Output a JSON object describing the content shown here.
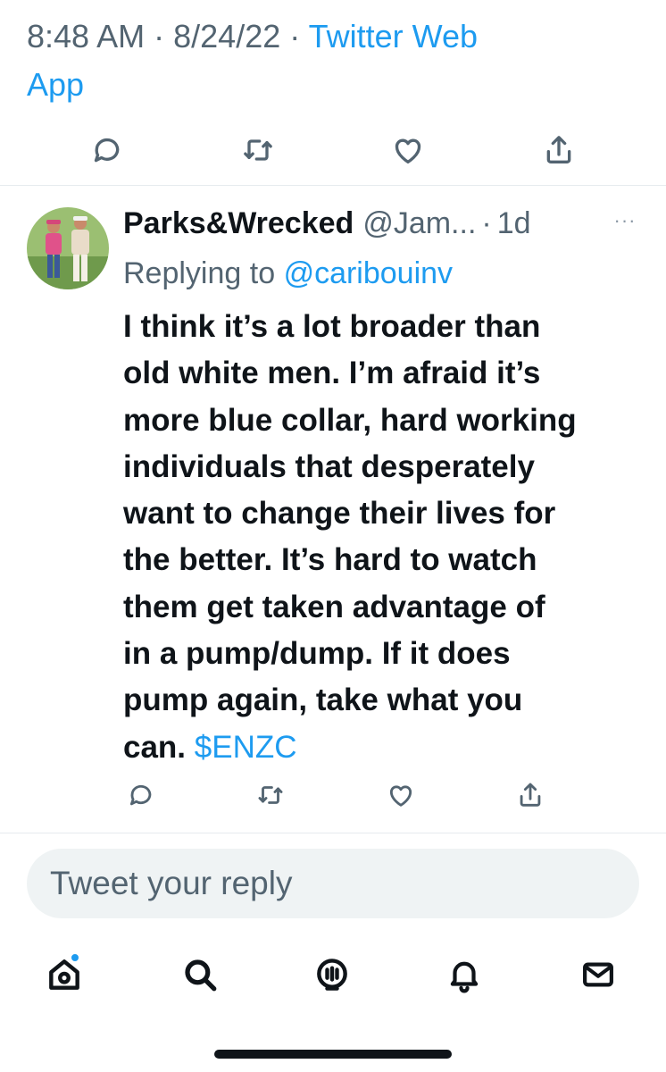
{
  "meta": {
    "time": "8:48 AM",
    "date": "8/24/22",
    "separator": "·",
    "source": "Twitter Web",
    "source_cont": "App"
  },
  "tweet": {
    "display_name": "Parks&Wrecked",
    "handle": "@Jam...",
    "age": "1d",
    "more": "···",
    "replying_prefix": "Replying to",
    "replying_to": "@caribouinv",
    "body_lines": [
      "I think it’s a lot broader than",
      "old white men. I’m afraid it’s",
      "more blue collar, hard working",
      "individuals that desperately",
      "want to change their lives for",
      "the better. It’s hard to watch",
      "them get taken advantage of",
      "in a pump/dump. If it does",
      "pump again, take what you",
      "can."
    ],
    "cashtag": "$ENZC"
  },
  "reply_box": {
    "placeholder": "Tweet your reply"
  },
  "icons": {
    "actions": [
      "comment-icon",
      "retweet-icon",
      "like-icon",
      "share-icon"
    ],
    "tabs": [
      "home-icon",
      "search-icon",
      "spaces-icon",
      "notifications-icon",
      "messages-icon"
    ]
  },
  "colors": {
    "accent": "#1d9bf0",
    "secondary_text": "#536471",
    "primary_text": "#0f1419",
    "reply_box_bg": "#eff3f4"
  }
}
